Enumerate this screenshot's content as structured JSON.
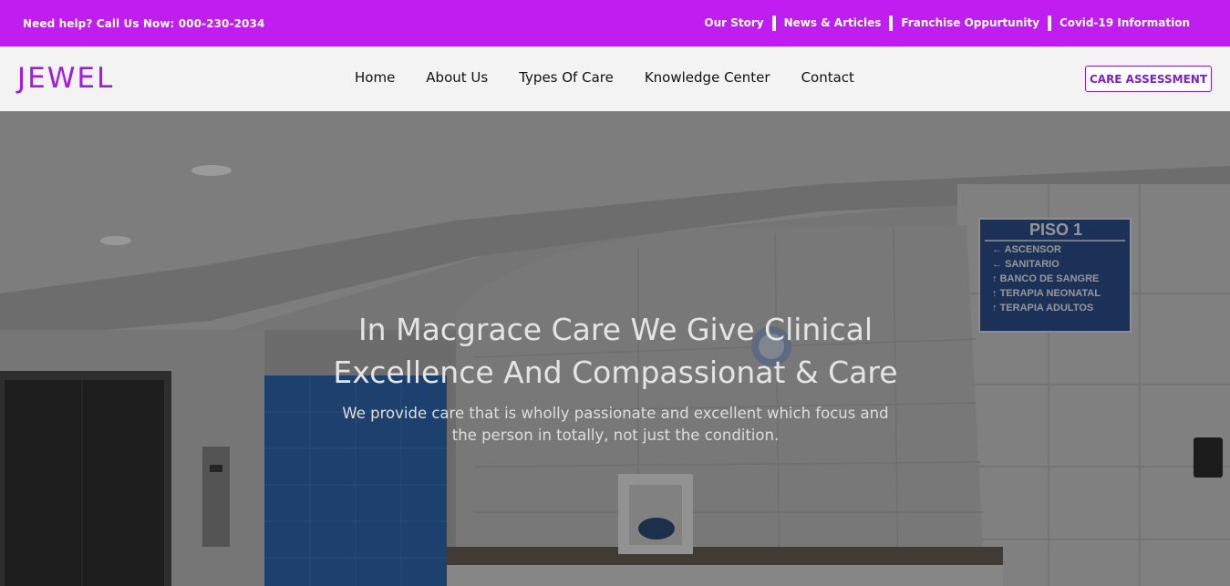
{
  "topbar": {
    "help_text": "Need help? Call Us Now: 000-230-2034",
    "links": [
      "Our Story",
      "News & Articles",
      "Franchise Oppurtunity",
      "Covid-19 Information"
    ]
  },
  "nav": {
    "logo": "JEWEL",
    "items": [
      "Home",
      "About Us",
      "Types Of Care",
      "Knowledge Center",
      "Contact"
    ],
    "cta_label": "CARE ASSESSMENT"
  },
  "hero": {
    "title_line1": "In Macgrace Care We Give Clinical",
    "title_line2": "Excellence And Compassionat & Care",
    "subtitle_line1": "We provide care that is wholly passionate and excellent which focus and",
    "subtitle_line2": "the person in totally, not just the condition.",
    "sign": {
      "heading": "PISO 1",
      "rows": [
        "ASCENSOR",
        "SANITARIO",
        "BANCO DE SANGRE",
        "TERAPIA NEONATAL",
        "TERAPIA ADULTOS"
      ]
    }
  },
  "colors": {
    "topbar_bg": "#c01ef0",
    "logo": "#a21ae4",
    "cta_border": "#7a22c4",
    "nav_bg": "#f3f3f3"
  }
}
